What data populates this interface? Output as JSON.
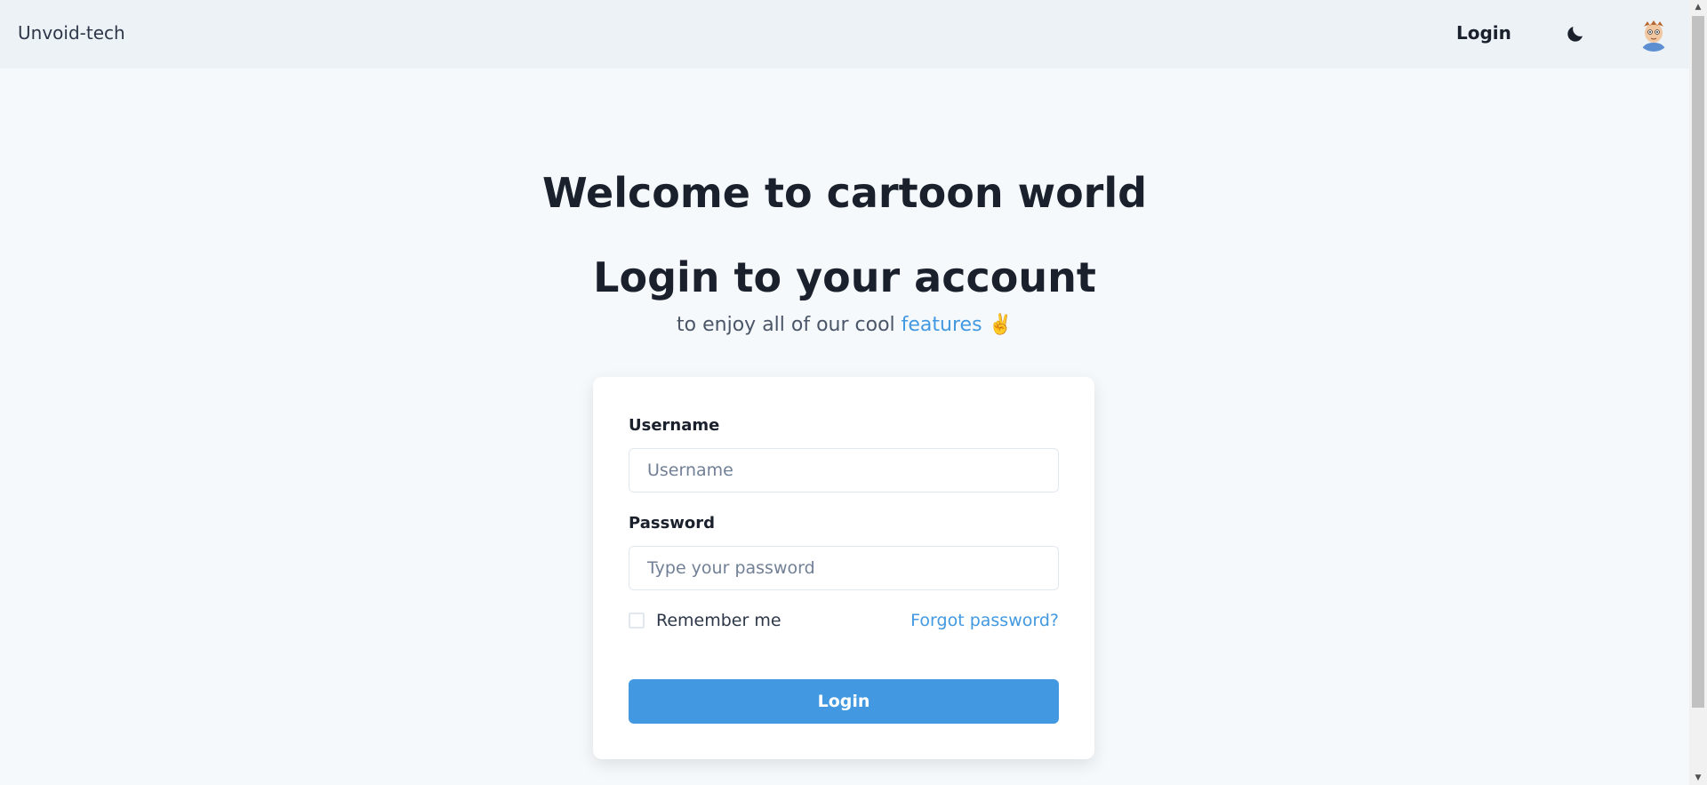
{
  "header": {
    "brand": "Unvoid-tech",
    "login_label": "Login",
    "theme_icon": "moon-icon",
    "avatar_icon": "cartoon-avatar"
  },
  "main": {
    "welcome": "Welcome to cartoon world",
    "heading": "Login to your account",
    "subtitle_prefix": "to enjoy all of our cool",
    "subtitle_link": "features",
    "subtitle_emoji": "✌️"
  },
  "form": {
    "username_label": "Username",
    "username_placeholder": "Username",
    "username_value": "",
    "password_label": "Password",
    "password_placeholder": "Type your password",
    "password_value": "",
    "remember_label": "Remember me",
    "remember_checked": false,
    "forgot_label": "Forgot password?",
    "submit_label": "Login"
  },
  "colors": {
    "accent": "#4299e1",
    "header_bg": "#edf2f7",
    "page_bg": "#f5f9fc"
  }
}
